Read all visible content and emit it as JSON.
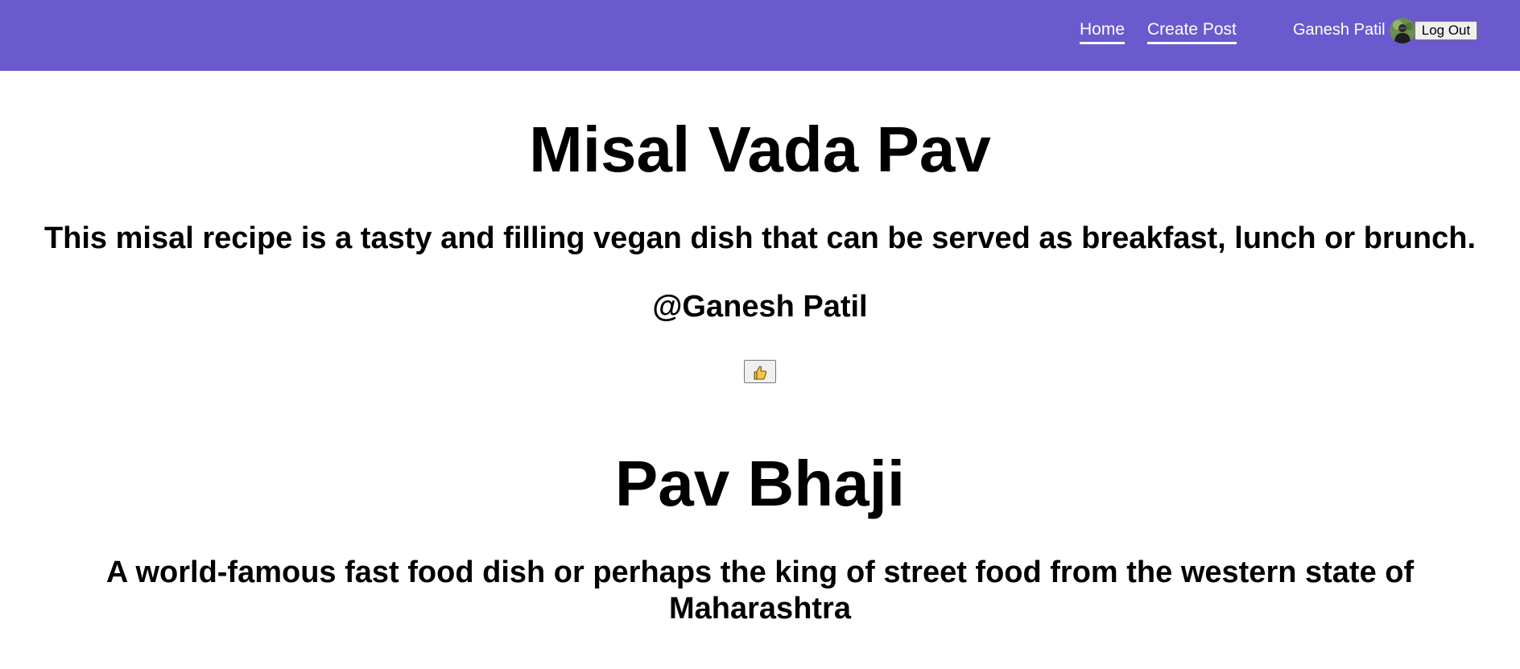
{
  "nav": {
    "home_label": "Home",
    "create_post_label": "Create Post",
    "user_name": "Ganesh Patil",
    "logout_label": "Log Out",
    "background_color": "#6a5acd"
  },
  "posts": [
    {
      "title": "Misal Vada Pav",
      "description": "This misal recipe is a tasty and filling vegan dish that can be served as breakfast, lunch or brunch.",
      "author": "@Ganesh Patil",
      "like_icon": "thumbs-up-icon"
    },
    {
      "title": "Pav Bhaji",
      "description": "A world-famous fast food dish or perhaps the king of street food from the western state of Maharashtra"
    }
  ]
}
